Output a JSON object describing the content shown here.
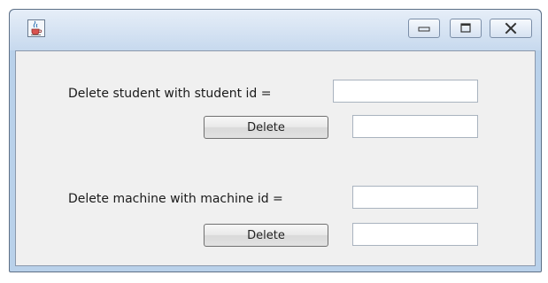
{
  "window": {
    "title": "",
    "controls": [
      "minimize-icon",
      "maximize-icon",
      "close-icon"
    ]
  },
  "student": {
    "label": "Delete student with student id =",
    "id_value": "",
    "button_label": "Delete",
    "result_value": ""
  },
  "machine": {
    "label": "Delete machine with machine id =",
    "id_value": "",
    "button_label": "Delete",
    "result_value": ""
  }
}
